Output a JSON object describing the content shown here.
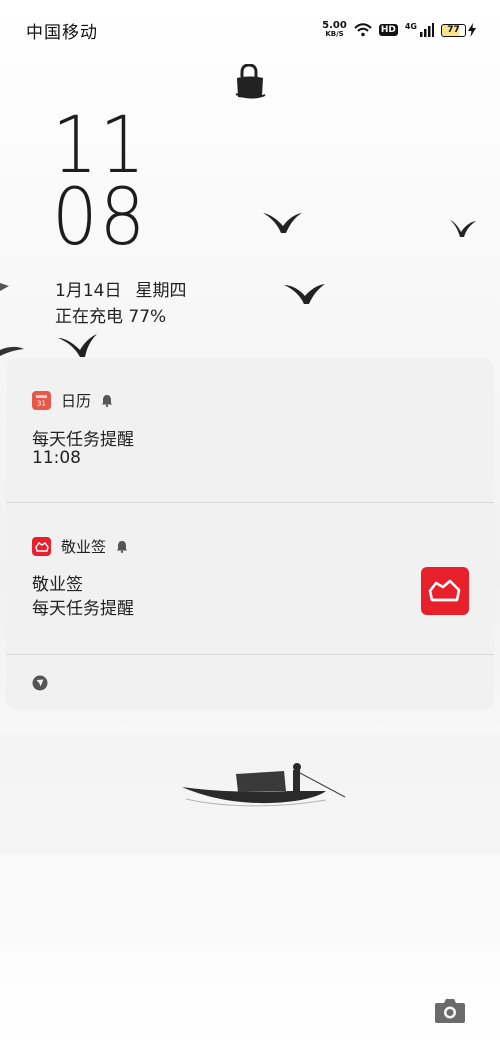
{
  "status_bar": {
    "carrier": "中国移动",
    "net_speed_value": "5.00",
    "net_speed_unit": "KB/S",
    "hd": "HD",
    "signal_type": "4G",
    "battery_level": "77"
  },
  "lockscreen": {
    "hour": "11",
    "minute": "08",
    "date": "1月14日",
    "weekday": "星期四",
    "charging": "正在充电 77%"
  },
  "notifications": [
    {
      "app_name": "日历",
      "title": "每天任务提醒",
      "body": "11:08",
      "icon": "calendar-icon",
      "icon_color": "#e8584a"
    },
    {
      "app_name": "敬业签",
      "title": "敬业签",
      "body": "每天任务提醒",
      "icon": "jingyeqian-icon",
      "icon_color": "#e8202c"
    }
  ],
  "colors": {
    "panel_bg": "#f0f0f0",
    "accent_red": "#e8202c"
  }
}
